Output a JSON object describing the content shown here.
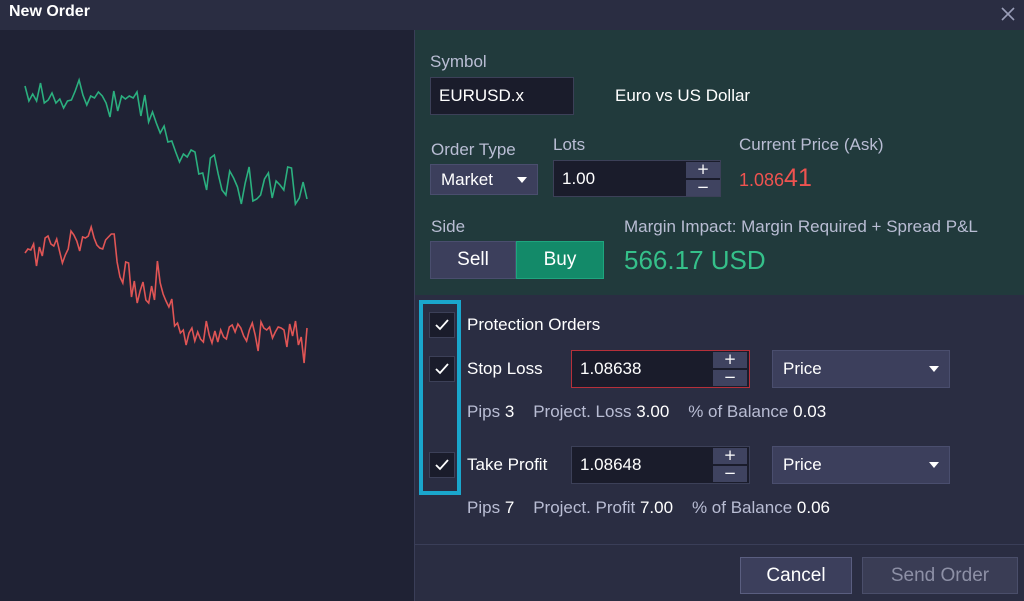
{
  "window": {
    "title": "New Order",
    "close_icon": "close-icon"
  },
  "colors": {
    "buy": "#138a69",
    "price_ask": "#ef5350",
    "margin_value": "#35c08a",
    "highlight": "#1aa6cc",
    "spark_green": "#2bb07f",
    "spark_red": "#e05555"
  },
  "symbol": {
    "label": "Symbol",
    "value": "EURUSD.x",
    "description": "Euro vs US Dollar"
  },
  "order_type": {
    "label": "Order Type",
    "selected": "Market"
  },
  "lots": {
    "label": "Lots",
    "value": "1.00",
    "plus": "+",
    "minus": "−"
  },
  "current_price": {
    "label": "Current Price (Ask)",
    "main": "1.086",
    "pips": "41"
  },
  "side": {
    "label": "Side",
    "sell": "Sell",
    "buy": "Buy",
    "selected": "Buy"
  },
  "margin": {
    "label": "Margin Impact: Margin Required + Spread P&L",
    "value": "566.17 USD"
  },
  "protection": {
    "label": "Protection Orders",
    "checked": true
  },
  "stop_loss": {
    "label": "Stop Loss",
    "checked": true,
    "value": "1.08638",
    "mode": "Price",
    "plus": "+",
    "minus": "−",
    "pips_label": "Pips",
    "pips": "3",
    "proj_label": "Project. Loss",
    "proj": "3.00",
    "bal_label": "% of Balance",
    "bal": "0.03"
  },
  "take_profit": {
    "label": "Take Profit",
    "checked": true,
    "value": "1.08648",
    "mode": "Price",
    "plus": "+",
    "minus": "−",
    "pips_label": "Pips",
    "pips": "7",
    "proj_label": "Project. Profit",
    "proj": "7.00",
    "bal_label": "% of Balance",
    "bal": "0.06"
  },
  "actions": {
    "cancel": "Cancel",
    "send": "Send Order"
  },
  "sparklines": {
    "green": [
      86,
      101,
      94,
      101,
      83,
      103,
      100,
      93,
      103,
      99,
      108,
      101,
      100,
      91,
      80,
      95,
      105,
      96,
      98,
      92,
      96,
      103,
      117,
      91,
      111,
      96,
      99,
      96,
      98,
      92,
      116,
      95,
      122,
      112,
      123,
      133,
      126,
      142,
      141,
      152,
      162,
      154,
      157,
      150,
      152,
      174,
      173,
      190,
      158,
      155,
      174,
      190,
      195,
      171,
      178,
      187,
      204,
      183,
      167,
      201,
      199,
      195,
      179,
      173,
      198,
      181,
      185,
      190,
      167,
      168,
      204,
      198,
      182,
      199
    ],
    "red": [
      253,
      249,
      250,
      244,
      266,
      247,
      256,
      238,
      236,
      244,
      246,
      239,
      251,
      263,
      255,
      249,
      231,
      235,
      241,
      251,
      237,
      238,
      236,
      227,
      238,
      245,
      248,
      249,
      240,
      237,
      234,
      234,
      262,
      277,
      283,
      262,
      263,
      297,
      281,
      303,
      291,
      282,
      300,
      303,
      286,
      300,
      261,
      283,
      294,
      301,
      307,
      299,
      326,
      323,
      333,
      330,
      345,
      333,
      328,
      341,
      332,
      339,
      342,
      321,
      335,
      343,
      331,
      342,
      330,
      337,
      339,
      327,
      325,
      332,
      324,
      328,
      336,
      341,
      330,
      323,
      335,
      351,
      322,
      328,
      330,
      327,
      338,
      332,
      327,
      328,
      330,
      347,
      324,
      336,
      321,
      345,
      337,
      363,
      328
    ]
  }
}
